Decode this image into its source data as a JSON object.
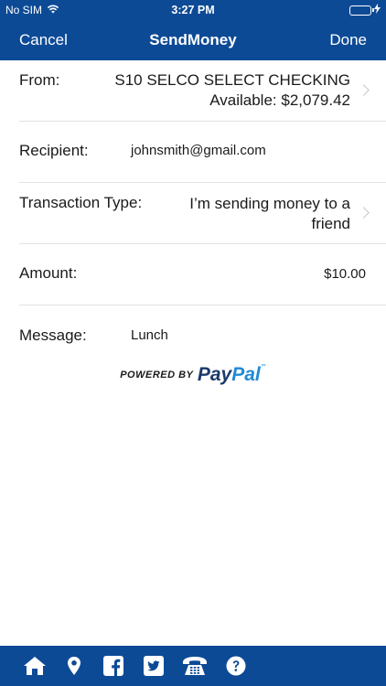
{
  "status": {
    "carrier": "No SIM",
    "time": "3:27 PM"
  },
  "nav": {
    "cancel": "Cancel",
    "title": "SendMoney",
    "done": "Done"
  },
  "form": {
    "from_label": "From:",
    "from_account": "S10 SELCO SELECT CHECKING",
    "from_available": "Available: $2,079.42",
    "recipient_label": "Recipient:",
    "recipient_value": "johnsmith@gmail.com",
    "type_label": "Transaction Type:",
    "type_value_line1": "I’m sending money to a",
    "type_value_line2": "friend",
    "amount_label": "Amount:",
    "amount_value": "$10.00",
    "message_label": "Message:",
    "message_value": "Lunch"
  },
  "powered": {
    "prefix": "POWERED BY",
    "pay": "Pay",
    "pal": "Pal",
    "tm": "™"
  },
  "tabbar": {
    "icons": [
      "home-icon",
      "location-icon",
      "facebook-icon",
      "twitter-icon",
      "phone-icon",
      "help-icon"
    ]
  },
  "colors": {
    "brand": "#0d4a96",
    "paypal_dark": "#1b3a6b",
    "paypal_light": "#1f8ad6",
    "battery": "#4cd964"
  }
}
